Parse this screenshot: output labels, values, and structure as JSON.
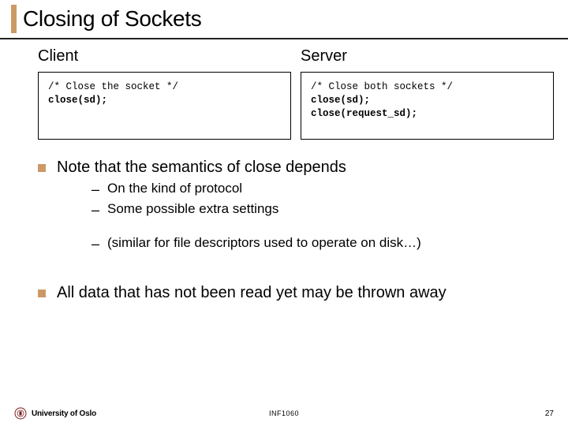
{
  "title": "Closing of Sockets",
  "columns": {
    "left": {
      "heading": "Client",
      "code_comment": "/* Close the socket */",
      "code_call": "close(sd);"
    },
    "right": {
      "heading": "Server",
      "code_comment": "/* Close both sockets */",
      "code_call1": "close(sd);",
      "code_call2": "close(request_sd);"
    }
  },
  "bullets": {
    "b1": "Note that the semantics of close depends",
    "b1_subs": {
      "s1": "On the kind of protocol",
      "s2": "Some possible extra settings",
      "s3": "(similar for file descriptors used to operate on disk…)"
    },
    "b2": "All data that has not been read yet may be thrown away"
  },
  "footer": {
    "university": "University of Oslo",
    "course": "INF1060",
    "page": "27"
  }
}
